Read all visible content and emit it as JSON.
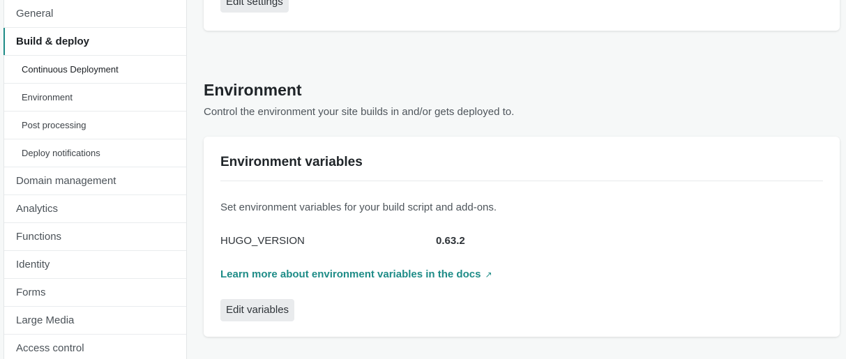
{
  "sidebar": {
    "items": [
      {
        "label": "General"
      },
      {
        "label": "Build & deploy"
      },
      {
        "label": "Continuous Deployment"
      },
      {
        "label": "Environment"
      },
      {
        "label": "Post processing"
      },
      {
        "label": "Deploy notifications"
      },
      {
        "label": "Domain management"
      },
      {
        "label": "Analytics"
      },
      {
        "label": "Functions"
      },
      {
        "label": "Identity"
      },
      {
        "label": "Forms"
      },
      {
        "label": "Large Media"
      },
      {
        "label": "Access control"
      }
    ]
  },
  "top_card": {
    "edit_settings_label": "Edit settings"
  },
  "environment": {
    "title": "Environment",
    "description": "Control the environment your site builds in and/or gets deployed to.",
    "card": {
      "title": "Environment variables",
      "description": "Set environment variables for your build script and add-ons.",
      "variables": [
        {
          "key": "HUGO_VERSION",
          "value": "0.63.2"
        }
      ],
      "docs_link": "Learn more about environment variables in the docs",
      "edit_label": "Edit variables"
    }
  },
  "icons": {
    "external_link": "external-link-icon"
  },
  "colors": {
    "accent": "#1e8c87",
    "background": "#f6f8f8",
    "button_bg": "#e9ebed"
  }
}
